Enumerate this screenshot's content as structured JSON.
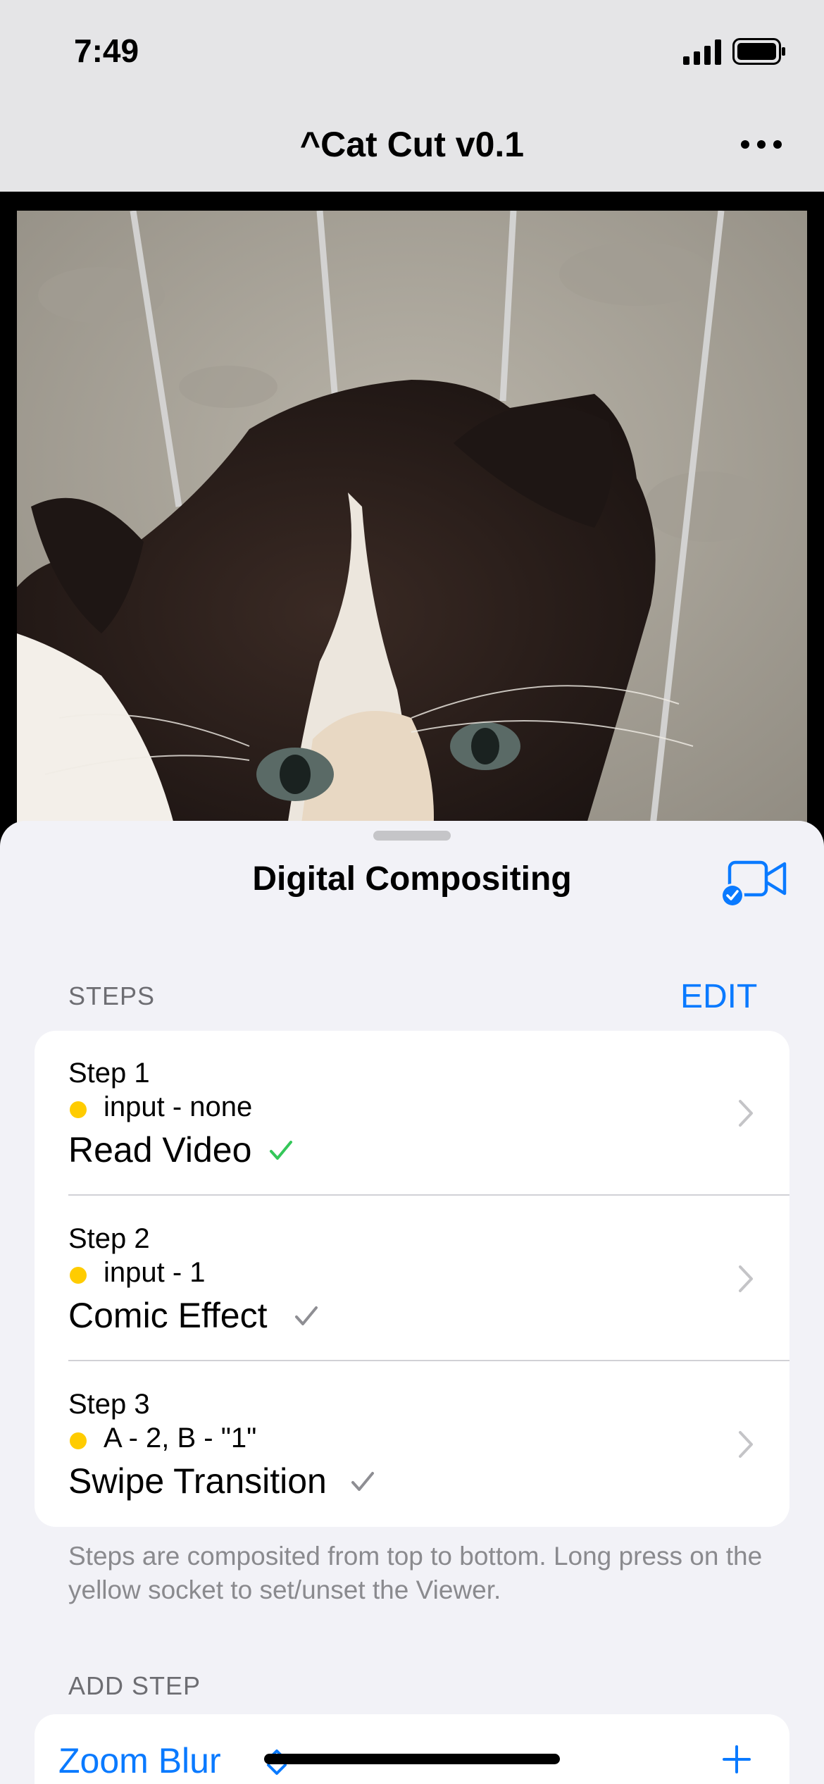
{
  "status_bar": {
    "time": "7:49",
    "signal_icon": "cellular-signal-icon",
    "battery_icon": "battery-icon"
  },
  "nav": {
    "title": "^Cat Cut v0.1",
    "more_icon": "ellipsis-icon"
  },
  "viewer": {
    "content": "kitten-video-frame"
  },
  "sheet": {
    "title": "Digital Compositing",
    "camera_icon": "video-camera-check-icon",
    "steps_header": "STEPS",
    "edit_label": "EDIT",
    "steps": [
      {
        "step": "Step 1",
        "input": "input - none",
        "effect": "Read Video",
        "check_color": "#34c759"
      },
      {
        "step": "Step 2",
        "input": "input - 1",
        "effect": "Comic Effect",
        "check_color": "#8e8e93"
      },
      {
        "step": "Step 3",
        "input": "A - 2, B - \"1\"",
        "effect": "Swipe Transition",
        "check_color": "#8e8e93"
      }
    ],
    "footnote": "Steps are composited from top to bottom. Long press on the yellow socket to set/unset the Viewer.",
    "add_step_header": "ADD STEP",
    "add_step_selected": "Zoom Blur"
  },
  "colors": {
    "accent": "#0a7aff",
    "socket": "#ffcc00",
    "sheet_bg": "#f2f2f7"
  }
}
